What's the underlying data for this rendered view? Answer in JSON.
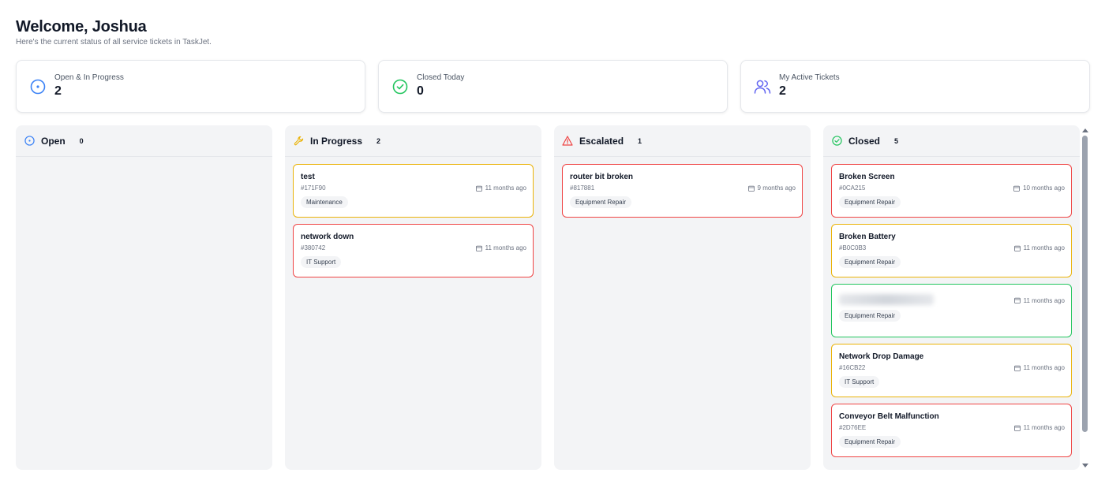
{
  "header": {
    "title": "Welcome, Joshua",
    "subtitle": "Here's the current status of all service tickets in TaskJet."
  },
  "stats": [
    {
      "label": "Open & In Progress",
      "value": "2",
      "icon": "target-icon",
      "color": "#3b82f6"
    },
    {
      "label": "Closed Today",
      "value": "0",
      "icon": "check-circle-icon",
      "color": "#22c55e"
    },
    {
      "label": "My Active Tickets",
      "value": "2",
      "icon": "users-icon",
      "color": "#6366f1"
    }
  ],
  "columns": [
    {
      "title": "Open",
      "count": "0",
      "icon": "target-icon",
      "color": "#3b82f6",
      "cards": []
    },
    {
      "title": "In Progress",
      "count": "2",
      "icon": "wrench-icon",
      "color": "#eab308",
      "cards": [
        {
          "title": "test",
          "id": "#171F90",
          "date": "11 months ago",
          "tag": "Maintenance",
          "border": "yellow"
        },
        {
          "title": "network down",
          "id": "#380742",
          "date": "11 months ago",
          "tag": "IT Support",
          "border": "red"
        }
      ]
    },
    {
      "title": "Escalated",
      "count": "1",
      "icon": "warning-icon",
      "color": "#ef4444",
      "cards": [
        {
          "title": "router bit broken",
          "id": "#817881",
          "date": "9 months ago",
          "tag": "Equipment Repair",
          "border": "red"
        }
      ]
    },
    {
      "title": "Closed",
      "count": "5",
      "icon": "check-circle-icon",
      "color": "#22c55e",
      "cards": [
        {
          "title": "Broken Screen",
          "id": "#0CA215",
          "date": "10 months ago",
          "tag": "Equipment Repair",
          "border": "red"
        },
        {
          "title": "Broken Battery",
          "id": "#B0C0B3",
          "date": "11 months ago",
          "tag": "Equipment Repair",
          "border": "yellow"
        },
        {
          "title": "",
          "id": "",
          "date": "11 months ago",
          "tag": "Equipment Repair",
          "border": "green",
          "blurred": true
        },
        {
          "title": "Network Drop Damage",
          "id": "#16CB22",
          "date": "11 months ago",
          "tag": "IT Support",
          "border": "yellow"
        },
        {
          "title": "Conveyor Belt Malfunction",
          "id": "#2D76EE",
          "date": "11 months ago",
          "tag": "Equipment Repair",
          "border": "red"
        }
      ]
    }
  ]
}
